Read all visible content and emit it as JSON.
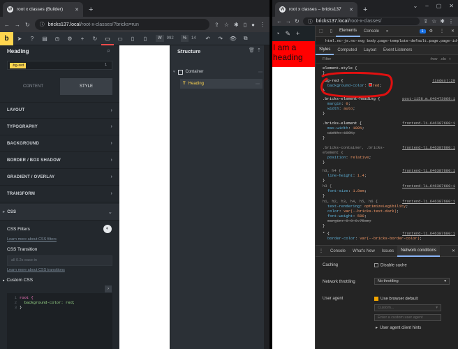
{
  "left_window": {
    "tab_title": "root x classes (Builder)",
    "url_host": "bricks137.local",
    "url_path": "/root-x-classes/?bricks=run",
    "toolbar": {
      "logo": "b",
      "width_label": "W",
      "width_value": "992",
      "percent_label": "%",
      "percent_value": "14"
    },
    "panel": {
      "title": "Heading",
      "class_chip": ".bg-red",
      "class_count": "1",
      "tab_content": "CONTENT",
      "tab_style": "STYLE",
      "sections": [
        "LAYOUT",
        "TYPOGRAPHY",
        "BACKGROUND",
        "BORDER / BOX SHADOW",
        "GRADIENT / OVERLAY",
        "TRANSFORM"
      ],
      "css_section": "CSS",
      "css_filters": "CSS Filters",
      "learn_filters": "Learn more about CSS filters",
      "css_transition": "CSS Transition",
      "transition_placeholder": "all 0.2s ease-in",
      "learn_transitions": "Learn more about CSS transitions",
      "custom_css": "Custom CSS",
      "code": [
        "root {",
        "  background-color: red;",
        "}"
      ]
    },
    "structure": {
      "title": "Structure",
      "items": [
        "Container",
        "Heading"
      ]
    }
  },
  "right_window": {
    "tab_title": "root x classes – bricks137",
    "url_host": "bricks137.local",
    "url_path": "/root-x-classes/",
    "page_heading": "I am a heading",
    "devtools": {
      "tabs": [
        "Elements",
        "Console"
      ],
      "badge": "1",
      "breadcrumb": "html.no-js.no-svg   body.page-template-default.page.page-id-1",
      "style_tabs": [
        "Styles",
        "Computed",
        "Layout",
        "Event Listeners"
      ],
      "filter_placeholder": "Filter",
      "hov": ":hov",
      "cls": ".cls",
      "rules": [
        {
          "selector": "element.style {",
          "lines": [],
          "source": ""
        },
        {
          "selector": ".bg-red {",
          "lines": [
            {
              "p": "background-color",
              "v": "red"
            }
          ],
          "source": "(index):20"
        },
        {
          "selector": ".bricks-element-heading {",
          "lines": [
            {
              "p": "margin",
              "v": "0"
            },
            {
              "p": "width",
              "v": "auto"
            }
          ],
          "source": "post-1158.m…646473069:1"
        },
        {
          "selector": ".bricks-element {",
          "lines": [
            {
              "p": "max-width",
              "v": "100%"
            },
            {
              "p": "width",
              "v": "100%"
            }
          ],
          "source": "frontend-li…646387680:1"
        },
        {
          "selector": ".bricks-container, .bricks-element {",
          "lines": [
            {
              "p": "position",
              "v": "relative"
            }
          ],
          "source": "frontend-li…646387680:1"
        },
        {
          "selector": "h3, h4 {",
          "lines": [
            {
              "p": "line-height",
              "v": "1.4"
            }
          ],
          "source": "frontend-li…646387680:1"
        },
        {
          "selector": "h3 {",
          "lines": [
            {
              "p": "font-size",
              "v": "1.8em"
            }
          ],
          "source": "frontend-li…646387680:1"
        },
        {
          "selector": "h1, h2, h3, h4, h5, h6 {",
          "lines": [
            {
              "p": "text-rendering",
              "v": "optimizeLegibility"
            },
            {
              "p": "color",
              "v": "var(--bricks-text-dark)"
            },
            {
              "p": "font-weight",
              "v": "500"
            },
            {
              "p": "margin",
              "v": "0 0 0.75em"
            }
          ],
          "source": "frontend-li…646387680:1"
        },
        {
          "selector": "* {",
          "lines": [
            {
              "p": "border-color",
              "v": "var(--bricks-border-color)"
            }
          ],
          "source": "frontend-li…646387680:1"
        }
      ],
      "drawer_tabs": [
        "Console",
        "What's New",
        "Issues",
        "Network conditions"
      ],
      "caching": "Caching",
      "disable_cache": "Disable cache",
      "network_throttling": "Network throttling",
      "throttling_value": "No throttling",
      "user_agent": "User agent",
      "use_browser_default": "Use browser default",
      "custom": "Custom...",
      "enter_custom_ua": "Enter a custom user agent",
      "client_hints": "User agent client hints"
    }
  }
}
